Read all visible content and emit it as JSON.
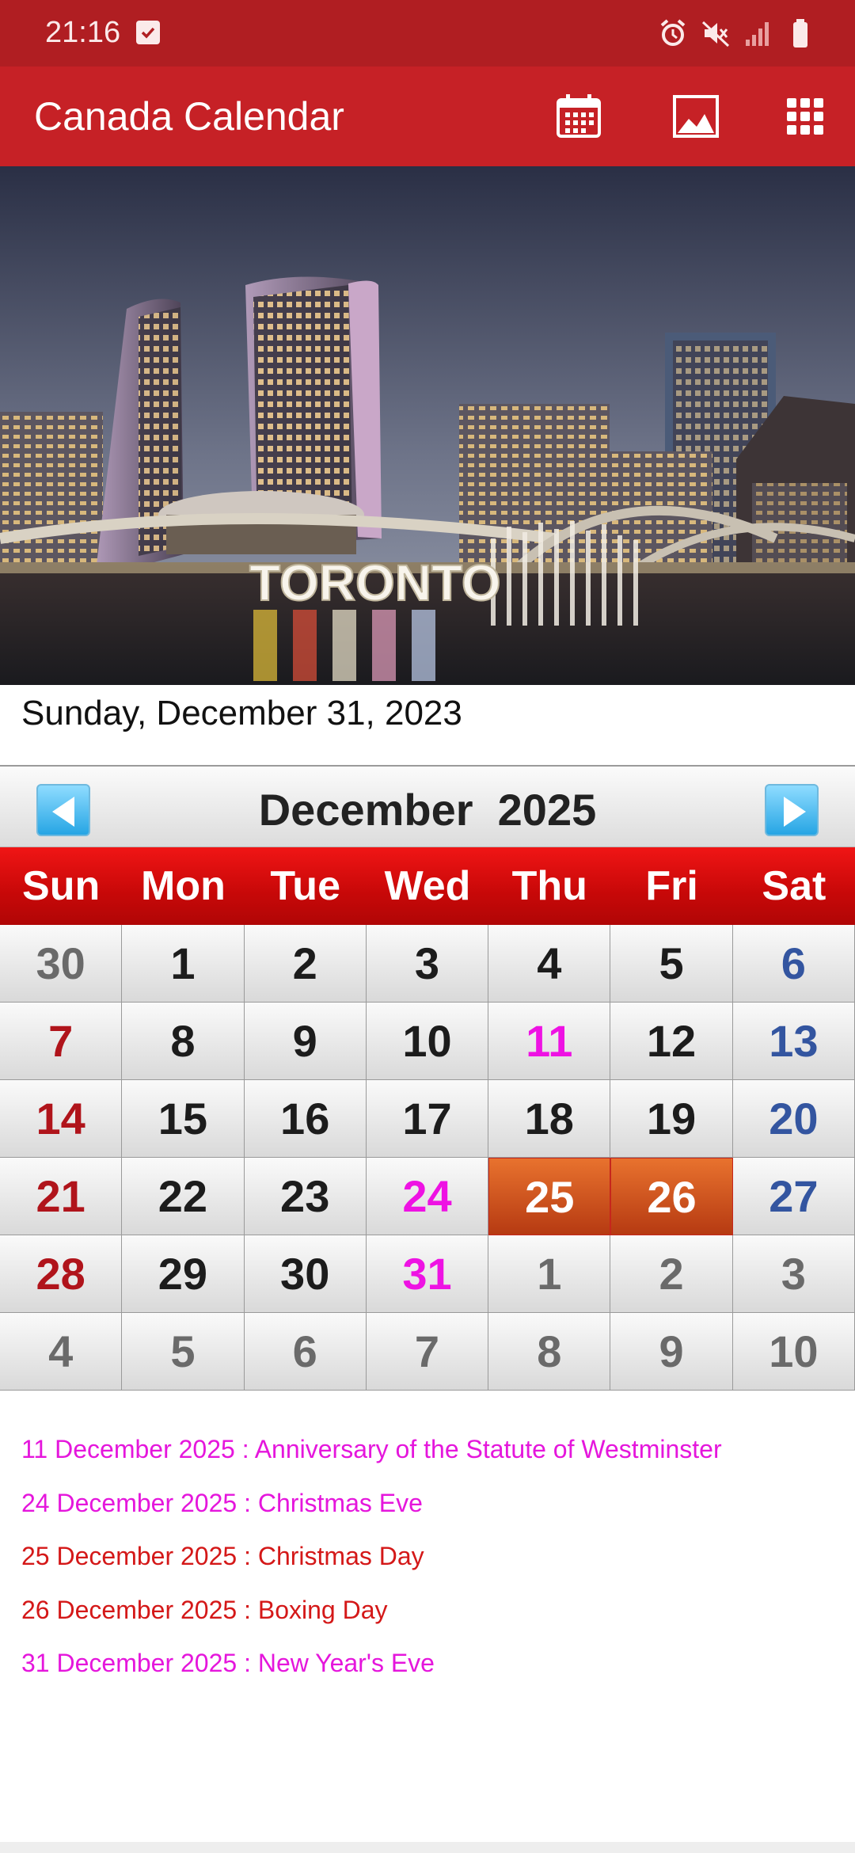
{
  "status_bar": {
    "time": "21:16",
    "icons": [
      "checkbox-notification-icon",
      "alarm-icon",
      "mute-icon",
      "signal-icon",
      "battery-icon"
    ]
  },
  "app_bar": {
    "title": "Canada Calendar",
    "actions": [
      "calendar-icon",
      "image-icon",
      "grid-menu-icon"
    ],
    "color": "#c62126"
  },
  "hero": {
    "sign_text": "TORONTO"
  },
  "today_label": "Sunday, December 31, 2023",
  "calendar": {
    "month_title": "December  2025",
    "prev_icon": "arrow-left-icon",
    "next_icon": "arrow-right-icon",
    "weekdays": [
      "Sun",
      "Mon",
      "Tue",
      "Wed",
      "Thu",
      "Fri",
      "Sat"
    ],
    "weeks": [
      [
        {
          "d": "30",
          "t": "dim"
        },
        {
          "d": "1",
          "t": ""
        },
        {
          "d": "2",
          "t": ""
        },
        {
          "d": "3",
          "t": ""
        },
        {
          "d": "4",
          "t": ""
        },
        {
          "d": "5",
          "t": ""
        },
        {
          "d": "6",
          "t": "sat"
        }
      ],
      [
        {
          "d": "7",
          "t": "sun"
        },
        {
          "d": "8",
          "t": ""
        },
        {
          "d": "9",
          "t": ""
        },
        {
          "d": "10",
          "t": ""
        },
        {
          "d": "11",
          "t": "holiday"
        },
        {
          "d": "12",
          "t": ""
        },
        {
          "d": "13",
          "t": "sat"
        }
      ],
      [
        {
          "d": "14",
          "t": "sun"
        },
        {
          "d": "15",
          "t": ""
        },
        {
          "d": "16",
          "t": ""
        },
        {
          "d": "17",
          "t": ""
        },
        {
          "d": "18",
          "t": ""
        },
        {
          "d": "19",
          "t": ""
        },
        {
          "d": "20",
          "t": "sat"
        }
      ],
      [
        {
          "d": "21",
          "t": "sun"
        },
        {
          "d": "22",
          "t": ""
        },
        {
          "d": "23",
          "t": ""
        },
        {
          "d": "24",
          "t": "holiday"
        },
        {
          "d": "25",
          "t": "stat"
        },
        {
          "d": "26",
          "t": "stat"
        },
        {
          "d": "27",
          "t": "sat"
        }
      ],
      [
        {
          "d": "28",
          "t": "sun"
        },
        {
          "d": "29",
          "t": ""
        },
        {
          "d": "30",
          "t": ""
        },
        {
          "d": "31",
          "t": "holiday"
        },
        {
          "d": "1",
          "t": "dim"
        },
        {
          "d": "2",
          "t": "dim"
        },
        {
          "d": "3",
          "t": "dim"
        }
      ],
      [
        {
          "d": "4",
          "t": "dim"
        },
        {
          "d": "5",
          "t": "dim"
        },
        {
          "d": "6",
          "t": "dim"
        },
        {
          "d": "7",
          "t": "dim"
        },
        {
          "d": "8",
          "t": "dim"
        },
        {
          "d": "9",
          "t": "dim"
        },
        {
          "d": "10",
          "t": "dim"
        }
      ]
    ]
  },
  "holidays": [
    {
      "text": "11 December 2025 : Anniversary of the Statute of Westminster",
      "style": "pink"
    },
    {
      "text": "24 December 2025 : Christmas Eve",
      "style": "pink"
    },
    {
      "text": "25 December 2025 : Christmas Day",
      "style": "red"
    },
    {
      "text": "26 December 2025 : Boxing Day",
      "style": "red"
    },
    {
      "text": "31 December 2025 : New Year's Eve",
      "style": "pink"
    }
  ]
}
